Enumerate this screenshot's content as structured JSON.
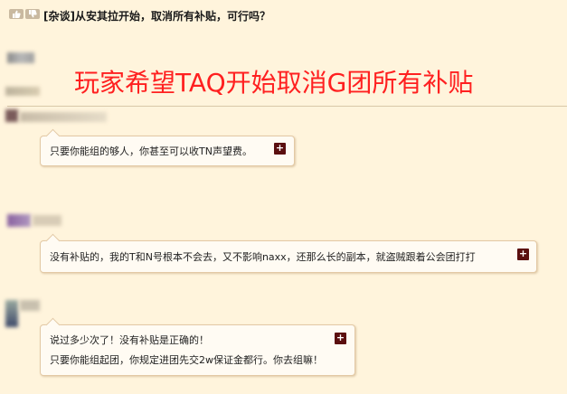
{
  "thread": {
    "title": "[杂谈]从安其拉开始，取消所有补贴，可行吗？",
    "headline": "玩家希望TAQ开始取消G团所有补贴"
  },
  "icons": {
    "upvote": "thumbs-up-icon",
    "downvote": "thumbs-down-icon",
    "expand": "plus-icon"
  },
  "posts": [
    {
      "lines": [
        "只要你能组的够人，你甚至可以收TN声望费。"
      ],
      "expand_label": "+"
    },
    {
      "lines": [
        "没有补贴的，我的T和N号根本不会去，又不影响naxx，还那么长的副本，就盗贼跟着公会团打打"
      ],
      "expand_label": "+"
    },
    {
      "lines": [
        "说过多少次了！没有补贴是正确的！",
        "只要你能组起团，你规定进团先交2w保证金都行。你去组嘛！"
      ],
      "expand_label": "+"
    }
  ],
  "colors": {
    "background": "#fff4dc",
    "headline": "#ff2020",
    "expand_button": "#5b0f0f"
  }
}
